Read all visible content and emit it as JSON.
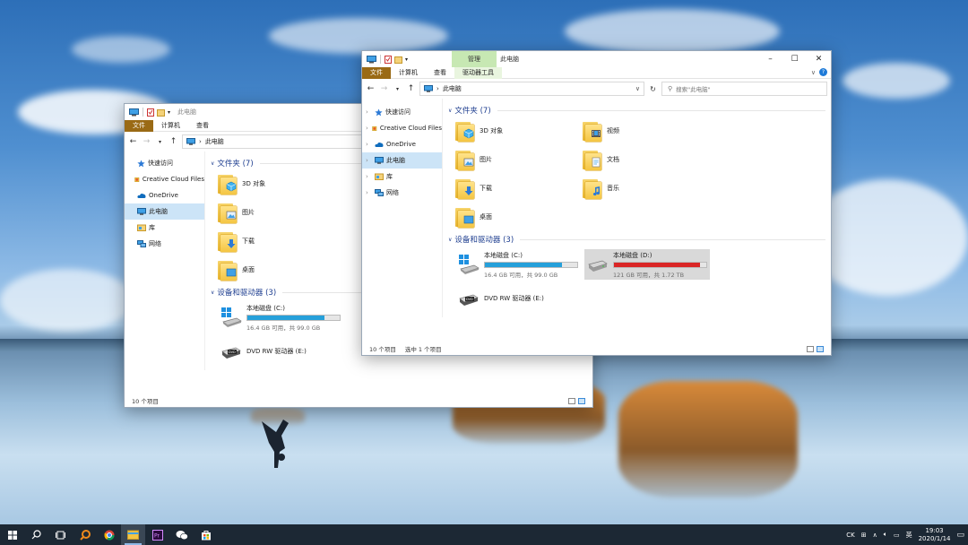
{
  "colors": {
    "file_tab": "#9a6a15",
    "manage_tab": "#c7e8b3",
    "selection": "#cce4f7",
    "group_heading": "#1d3d8f",
    "drive_ok": "#26a0da",
    "drive_full": "#da2626",
    "taskbar": "#1c2834"
  },
  "back_window": {
    "title": "此电脑",
    "ribbon_tabs": [
      "文件",
      "计算机",
      "查看"
    ],
    "address_path": "此电脑",
    "sidebar": [
      {
        "label": "快速访问",
        "icon": "star-icon"
      },
      {
        "label": "Creative Cloud Files",
        "icon": "creative-cloud-icon"
      },
      {
        "label": "OneDrive",
        "icon": "cloud-icon"
      },
      {
        "label": "此电脑",
        "icon": "computer-icon",
        "selected": true
      },
      {
        "label": "库",
        "icon": "library-icon"
      },
      {
        "label": "网络",
        "icon": "network-icon"
      }
    ],
    "folders_heading": "文件夹 (7)",
    "folders": [
      "3D 对象",
      "图片",
      "下载",
      "桌面"
    ],
    "drives_heading": "设备和驱动器 (3)",
    "drives": [
      {
        "name": "本地磁盘 (C:)",
        "free": "16.4 GB 可用，共 99.0 GB",
        "used_fraction": 0.834,
        "icon": "windows-drive-icon"
      },
      {
        "name": "DVD RW 驱动器 (E:)",
        "free": "",
        "used_fraction": null,
        "icon": "dvd-drive-icon"
      }
    ],
    "status_count": "10 个项目"
  },
  "front_window": {
    "title": "此电脑",
    "manage_label": "管理",
    "ribbon_tabs": [
      "文件",
      "计算机",
      "查看",
      "驱动器工具"
    ],
    "address_path": "此电脑",
    "search_placeholder": "搜索\"此电脑\"",
    "sidebar": [
      {
        "label": "快速访问",
        "icon": "star-icon"
      },
      {
        "label": "Creative Cloud Files",
        "icon": "creative-cloud-icon"
      },
      {
        "label": "OneDrive",
        "icon": "cloud-icon"
      },
      {
        "label": "此电脑",
        "icon": "computer-icon",
        "selected": true
      },
      {
        "label": "库",
        "icon": "library-icon"
      },
      {
        "label": "网络",
        "icon": "network-icon"
      }
    ],
    "folders_heading": "文件夹 (7)",
    "folders": [
      "3D 对象",
      "视频",
      "图片",
      "文档",
      "下载",
      "音乐",
      "桌面"
    ],
    "drives_heading": "设备和驱动器 (3)",
    "drives": [
      {
        "name": "本地磁盘 (C:)",
        "free": "16.4 GB 可用，共 99.0 GB",
        "used_fraction": 0.834,
        "icon": "windows-drive-icon"
      },
      {
        "name": "本地磁盘 (D:)",
        "free": "121 GB 可用，共 1.72 TB",
        "used_fraction": 0.931,
        "icon": "hdd-icon",
        "selected": true
      },
      {
        "name": "DVD RW 驱动器 (E:)",
        "free": "",
        "used_fraction": null,
        "icon": "dvd-drive-icon"
      }
    ],
    "status_count": "10 个项目",
    "status_selected": "选中 1 个项目"
  },
  "taskbar": {
    "apps": [
      "windows-start-icon",
      "search-icon",
      "task-view-icon",
      "everything-search-icon",
      "chrome-icon",
      "file-explorer-icon",
      "premiere-icon",
      "wechat-icon",
      "store-icon"
    ],
    "active_app": "file-explorer-icon",
    "tray_lang": "CK",
    "time": "19:03",
    "date": "2020/1/14"
  }
}
